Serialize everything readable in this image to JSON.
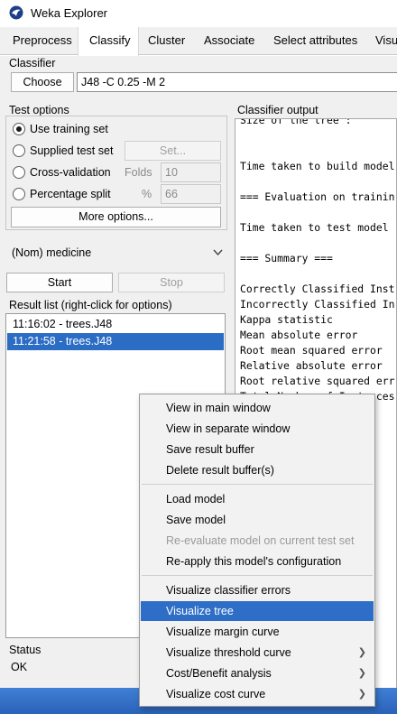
{
  "window": {
    "title": "Weka Explorer"
  },
  "tabs": [
    "Preprocess",
    "Classify",
    "Cluster",
    "Associate",
    "Select attributes",
    "Visu"
  ],
  "active_tab": "Classify",
  "classifier": {
    "group_label": "Classifier",
    "choose_label": "Choose",
    "spec": "J48 -C 0.25 -M 2"
  },
  "test_options": {
    "group_label": "Test options",
    "use_training_set": "Use training set",
    "supplied_test_set": "Supplied test set",
    "set_button": "Set...",
    "cross_validation": "Cross-validation",
    "folds_label": "Folds",
    "folds_value": "10",
    "percentage_split": "Percentage split",
    "percent_sign": "%",
    "percent_value": "66",
    "more_options": "More options..."
  },
  "class_attribute": {
    "value": "(Nom) medicine",
    "icon": "chevron-down-icon"
  },
  "run": {
    "start_label": "Start",
    "stop_label": "Stop"
  },
  "result_list": {
    "label": "Result list (right-click for options)",
    "items": [
      "11:16:02 - trees.J48",
      "11:21:58 - trees.J48"
    ]
  },
  "output": {
    "label": "Classifier output",
    "lines": [
      "Size of the tree :",
      "",
      "",
      "Time taken to build model",
      "",
      "=== Evaluation on trainin",
      "",
      "Time taken to test model",
      "",
      "=== Summary ===",
      "",
      "Correctly Classified Inst",
      "Incorrectly Classified In",
      "Kappa statistic",
      "Mean absolute error",
      "Root mean squared error",
      "Relative absolute error",
      "Root relative squared err",
      "Total Number of Instances"
    ]
  },
  "status": {
    "label": "Status",
    "value": "OK"
  },
  "context_menu": {
    "items": [
      "View in main window",
      "View in separate window",
      "Save result buffer",
      "Delete result buffer(s)",
      "Load model",
      "Save model",
      "Re-evaluate model on current test set",
      "Re-apply this model's configuration",
      "Visualize classifier errors",
      "Visualize tree",
      "Visualize margin curve",
      "Visualize threshold curve",
      "Cost/Benefit analysis",
      "Visualize cost curve"
    ],
    "selected": "Visualize tree",
    "disabled": [
      "Re-evaluate model on current test set"
    ],
    "submenu_icon": "chevron-right-icon"
  },
  "colors": {
    "selection": "#2b6cc4",
    "panel": "#f0f0f0"
  }
}
